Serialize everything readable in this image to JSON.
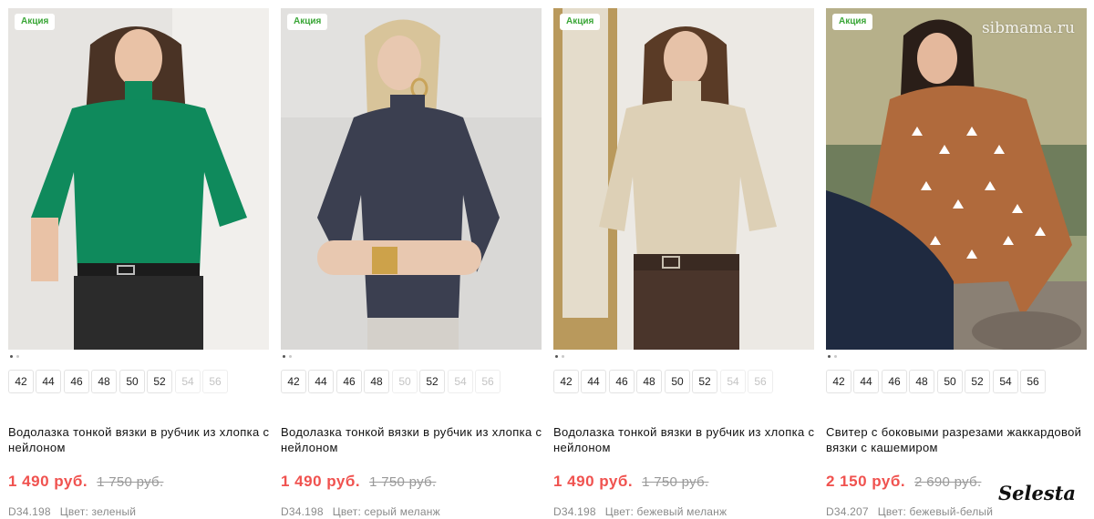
{
  "products": [
    {
      "badge": "Акция",
      "title": "Водолазка тонкой вязки в рубчик из хлопка с нейлоном",
      "price": "1 490 руб.",
      "old_price": "1 750 руб.",
      "code": "D34.198",
      "color": "Цвет: зеленый",
      "garment_color": "#0f8a5c",
      "sizes": [
        {
          "label": "42",
          "available": true
        },
        {
          "label": "44",
          "available": true
        },
        {
          "label": "46",
          "available": true
        },
        {
          "label": "48",
          "available": true
        },
        {
          "label": "50",
          "available": true
        },
        {
          "label": "52",
          "available": true
        },
        {
          "label": "54",
          "available": false
        },
        {
          "label": "56",
          "available": false
        }
      ]
    },
    {
      "badge": "Акция",
      "title": "Водолазка тонкой вязки в рубчик из хлопка с нейлоном",
      "price": "1 490 руб.",
      "old_price": "1 750 руб.",
      "code": "D34.198",
      "color": "Цвет: серый меланж",
      "garment_color": "#3b3f50",
      "sizes": [
        {
          "label": "42",
          "available": true
        },
        {
          "label": "44",
          "available": true
        },
        {
          "label": "46",
          "available": true
        },
        {
          "label": "48",
          "available": true
        },
        {
          "label": "50",
          "available": false
        },
        {
          "label": "52",
          "available": true
        },
        {
          "label": "54",
          "available": false
        },
        {
          "label": "56",
          "available": false
        }
      ]
    },
    {
      "badge": "Акция",
      "title": "Водолазка тонкой вязки в рубчик из хлопка с нейлоном",
      "price": "1 490 руб.",
      "old_price": "1 750 руб.",
      "code": "D34.198",
      "color": "Цвет: бежевый меланж",
      "garment_color": "#ddd0b6",
      "sizes": [
        {
          "label": "42",
          "available": true
        },
        {
          "label": "44",
          "available": true
        },
        {
          "label": "46",
          "available": true
        },
        {
          "label": "48",
          "available": true
        },
        {
          "label": "50",
          "available": true
        },
        {
          "label": "52",
          "available": true
        },
        {
          "label": "54",
          "available": false
        },
        {
          "label": "56",
          "available": false
        }
      ]
    },
    {
      "badge": "Акция",
      "title": "Свитер с боковыми разрезами жаккардовой вязки с кашемиром",
      "price": "2 150 руб.",
      "old_price": "2 690 руб.",
      "code": "D34.207",
      "color": "Цвет: бежевый-белый",
      "garment_color": "#b06a3c",
      "sizes": [
        {
          "label": "42",
          "available": true
        },
        {
          "label": "44",
          "available": true
        },
        {
          "label": "46",
          "available": true
        },
        {
          "label": "48",
          "available": true
        },
        {
          "label": "50",
          "available": true
        },
        {
          "label": "52",
          "available": true
        },
        {
          "label": "54",
          "available": true
        },
        {
          "label": "56",
          "available": true
        }
      ]
    }
  ],
  "watermark_site": "sibmama.ru",
  "watermark_brand": "Selesta",
  "colors": {
    "price": "#f0524f",
    "badge_text": "#3aa637",
    "old_price": "#9a9a9a"
  }
}
